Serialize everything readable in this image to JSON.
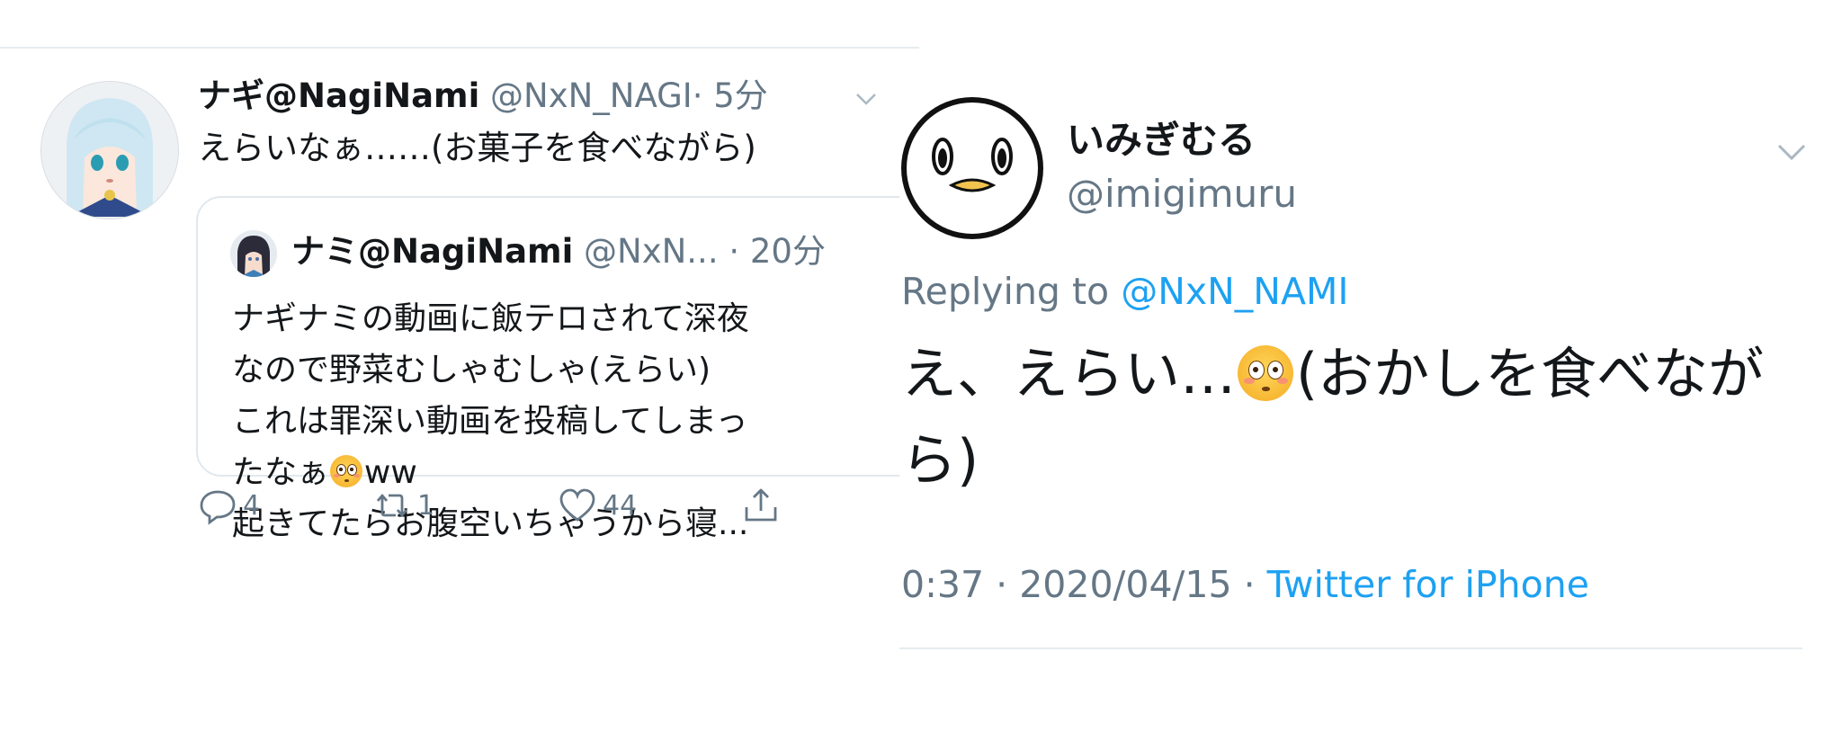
{
  "left_tweet": {
    "display_name": "ナギ@NagiNami",
    "handle": "@NxN_NAGI",
    "time": "· 5分",
    "text": "えらいなぁ……(お菓子を食べながら)",
    "quote": {
      "display_name": "ナミ@NagiNami",
      "handle": "@NxN...",
      "time": "· 20分",
      "lines": [
        "ナギナミの動画に飯テロされて深夜",
        "なので野菜むしゃむしゃ(えらい)",
        "これは罪深い動画を投稿してしまっ",
        "たなぁ",
        "起きてたらお腹空いちゃうから寝..."
      ],
      "line4_suffix": "ww"
    },
    "actions": {
      "reply_count": "4",
      "retweet_count": "1",
      "like_count": "44"
    }
  },
  "right_tweet": {
    "display_name": "いみぎむる",
    "handle": "@imigimuru",
    "replying_label": "Replying to",
    "replying_mention": "@NxN_NAMI",
    "text_line1_a": "え、えらい…",
    "text_line1_b": "(おかしを食べなが",
    "text_line2": "ら)",
    "time": "0:37",
    "separator": "·",
    "date": "2020/04/15",
    "source": "Twitter for iPhone"
  },
  "icons": {
    "reply": "reply-icon",
    "retweet": "retweet-icon",
    "like": "heart-icon",
    "share": "share-icon",
    "more": "chevron-down-icon",
    "emoji": "flushed-face-emoji"
  },
  "colors": {
    "link_blue": "#1da1f2",
    "muted_gray": "#657786",
    "text": "#14171a",
    "border": "#e1e8ed"
  }
}
